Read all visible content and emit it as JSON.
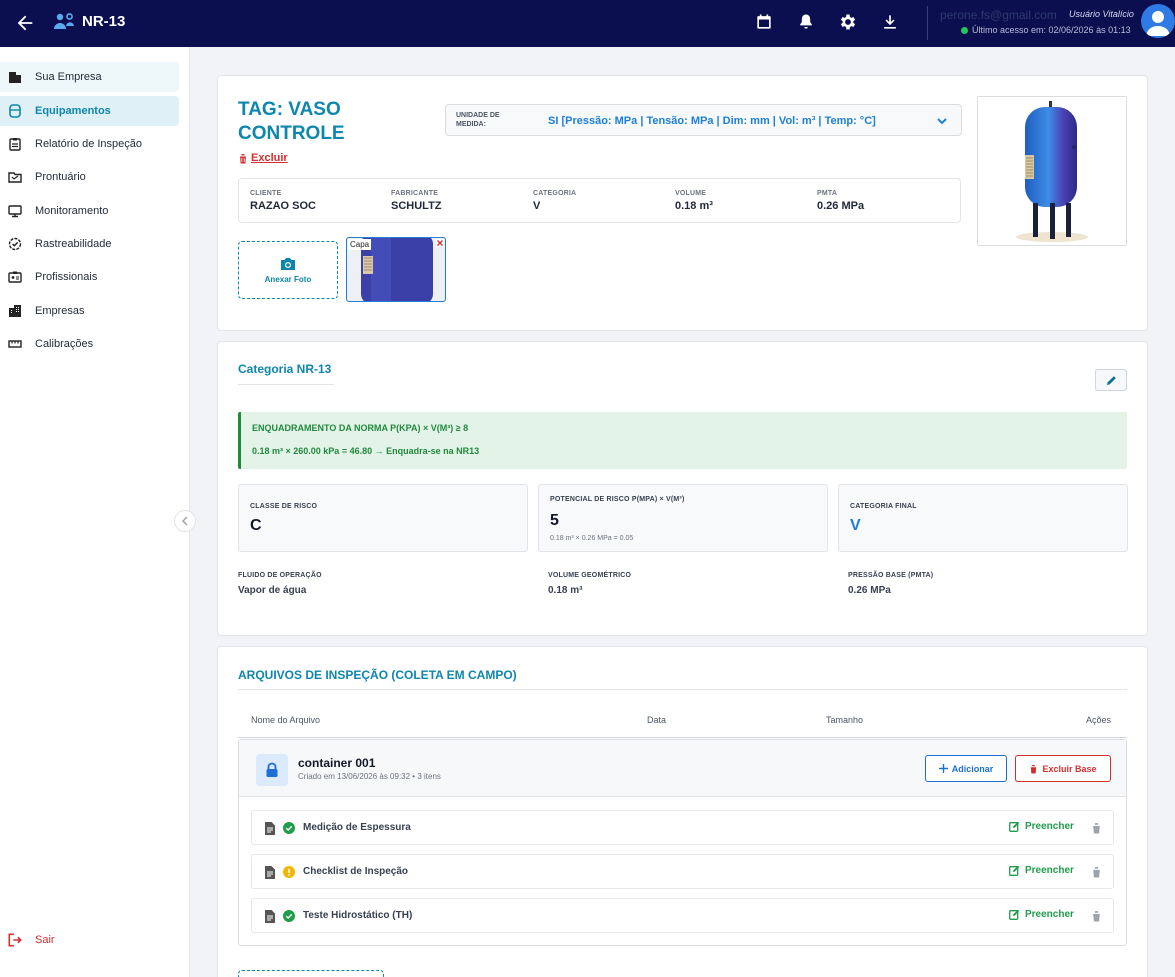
{
  "topbar": {
    "title": "NR-13",
    "email": "perone.fs@gmail.com",
    "role": "Usuário Vitalício",
    "last_access": "Último acesso em: 02/06/2026 às 01:13"
  },
  "sidebar": {
    "items": [
      {
        "label": "Sua Empresa",
        "icon": "building-icon"
      },
      {
        "label": "Equipamentos",
        "icon": "equipment-icon"
      },
      {
        "label": "Relatório de Inspeção",
        "icon": "clipboard-icon"
      },
      {
        "label": "Prontuário",
        "icon": "folder-icon"
      },
      {
        "label": "Monitoramento",
        "icon": "monitor-icon"
      },
      {
        "label": "Rastreabilidade",
        "icon": "check-badge-icon"
      },
      {
        "label": "Profissionais",
        "icon": "id-card-icon"
      },
      {
        "label": "Empresas",
        "icon": "buildings-icon"
      },
      {
        "label": "Calibrações",
        "icon": "ruler-icon"
      }
    ],
    "logout": "Sair"
  },
  "equipment": {
    "tag_title": "TAG: VASO CONTROLE",
    "delete_label": "Excluir",
    "unit_label": "UNIDADE DE MEDIDA:",
    "unit_value": "SI [Pressão: MPa | Tensão: MPa | Dim: mm | Vol: m³ | Temp: °C]",
    "fields": [
      {
        "key": "CLIENTE",
        "value": "RAZAO SOC"
      },
      {
        "key": "FABRICANTE",
        "value": "SCHULTZ"
      },
      {
        "key": "CATEGORIA",
        "value": "V"
      },
      {
        "key": "VOLUME",
        "value": "0.18 m³"
      },
      {
        "key": "PMTA",
        "value": "0.26 MPa"
      }
    ],
    "attach_label": "Anexar Foto",
    "thumb_caption": "Capa"
  },
  "category": {
    "title": "Categoria NR-13",
    "norm_line": "ENQUADRAMENTO DA NORMA P(KPA) × V(M³) ≥ 8",
    "calc_line": "0.18 m³ × 260.00 kPa = 46.80 → Enquadra-se na NR13",
    "risk_class_label": "CLASSE DE RISCO",
    "risk_class_value": "C",
    "potential_label": "POTENCIAL DE RISCO P(MPA) × V(M³)",
    "potential_value": "5",
    "potential_sub": "0.18 m³ × 0.26 MPa = 0.05",
    "final_label": "CATEGORIA FINAL",
    "final_value": "V",
    "fluid_label": "FLUIDO DE OPERAÇÃO",
    "fluid_value": "Vapor de água",
    "volume_label": "VOLUME GEOMÉTRICO",
    "volume_value": "0.18 m³",
    "pressure_label": "PRESSÃO BASE (PMTA)",
    "pressure_value": "0.26 MPa"
  },
  "files": {
    "title": "ARQUIVOS DE INSPEÇÃO (COLETA EM CAMPO)",
    "headers": [
      "Nome do Arquivo",
      "Data",
      "Tamanho",
      "Ações"
    ],
    "container": {
      "name": "container 001",
      "sub": "Criado em 13/06/2026 às 09:32 • 3 itens",
      "add_label": "Adicionar",
      "delete_label": "Excluir Base"
    },
    "rows": [
      {
        "name": "Medição de Espessura",
        "status": "complete",
        "action": "Preencher"
      },
      {
        "name": "Checklist de Inspeção",
        "status": "warning",
        "action": "Preencher"
      },
      {
        "name": "Teste Hidrostático (TH)",
        "status": "complete",
        "action": "Preencher"
      }
    ]
  },
  "colors": {
    "topbar": "#0b0f4f",
    "accent": "#0e86ad",
    "danger": "#d32f2f",
    "success": "#1f8a3c"
  }
}
